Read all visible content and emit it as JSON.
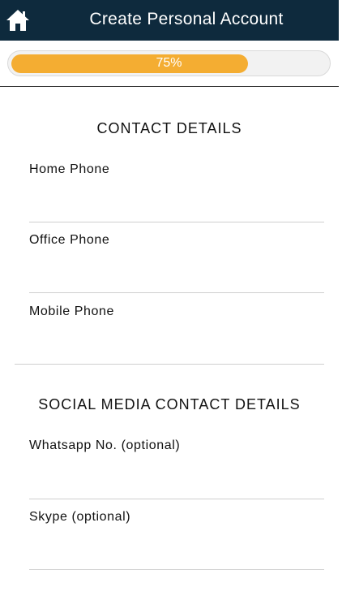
{
  "header": {
    "title": "Create Personal Account",
    "home_icon": "home-icon",
    "background_color": "#0e2a3d"
  },
  "progress": {
    "percent": 75,
    "label": "75%",
    "fill_color": "#f4ad32"
  },
  "contact_section": {
    "title": "CONTACT DETAILS",
    "fields": [
      {
        "label": "Home Phone",
        "value": ""
      },
      {
        "label": "Office Phone",
        "value": ""
      },
      {
        "label": "Mobile Phone",
        "value": ""
      }
    ]
  },
  "social_section": {
    "title": "SOCIAL MEDIA CONTACT DETAILS",
    "fields": [
      {
        "label": "Whatsapp No. (optional)",
        "value": ""
      },
      {
        "label": "Skype (optional)",
        "value": ""
      }
    ]
  }
}
